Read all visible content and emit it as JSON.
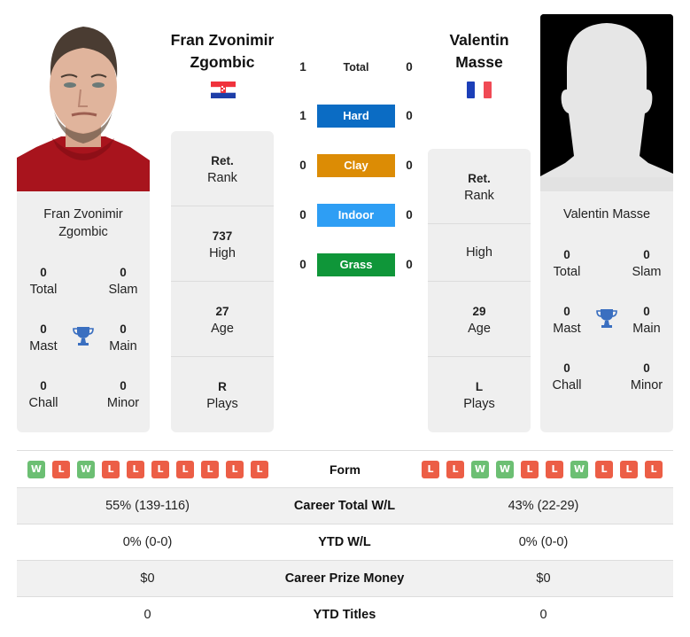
{
  "players": {
    "left": {
      "name": "Fran Zvonimir Zgombic",
      "header_name_line1": "Fran Zvonimir",
      "header_name_line2": "Zgombic",
      "card_name_line1": "Fran Zvonimir",
      "card_name_line2": "Zgombic",
      "country_flag": "croatia-flag",
      "titles": {
        "total": {
          "value": "0",
          "label": "Total"
        },
        "slam": {
          "value": "0",
          "label": "Slam"
        },
        "mast": {
          "value": "0",
          "label": "Mast"
        },
        "main": {
          "value": "0",
          "label": "Main"
        },
        "chall": {
          "value": "0",
          "label": "Chall"
        },
        "minor": {
          "value": "0",
          "label": "Minor"
        }
      },
      "rank": {
        "current": {
          "value": "Ret.",
          "label": "Rank"
        },
        "high": {
          "value": "737",
          "label": "High"
        },
        "age": {
          "value": "27",
          "label": "Age"
        },
        "plays": {
          "value": "R",
          "label": "Plays"
        }
      },
      "form": [
        "W",
        "L",
        "W",
        "L",
        "L",
        "L",
        "L",
        "L",
        "L",
        "L"
      ]
    },
    "right": {
      "name": "Valentin Masse",
      "header_name_line1": "Valentin",
      "header_name_line2": "Masse",
      "card_name_line1": "Valentin Masse",
      "country_flag": "france-flag",
      "titles": {
        "total": {
          "value": "0",
          "label": "Total"
        },
        "slam": {
          "value": "0",
          "label": "Slam"
        },
        "mast": {
          "value": "0",
          "label": "Mast"
        },
        "main": {
          "value": "0",
          "label": "Main"
        },
        "chall": {
          "value": "0",
          "label": "Chall"
        },
        "minor": {
          "value": "0",
          "label": "Minor"
        }
      },
      "rank": {
        "current": {
          "value": "Ret.",
          "label": "Rank"
        },
        "high": {
          "value": "",
          "label": "High"
        },
        "age": {
          "value": "29",
          "label": "Age"
        },
        "plays": {
          "value": "L",
          "label": "Plays"
        }
      },
      "form": [
        "L",
        "L",
        "W",
        "W",
        "L",
        "L",
        "W",
        "L",
        "L",
        "L"
      ]
    }
  },
  "h2h": [
    {
      "label": "Total",
      "left": "1",
      "right": "0",
      "color": ""
    },
    {
      "label": "Hard",
      "left": "1",
      "right": "0",
      "color": "#0b6cc4"
    },
    {
      "label": "Clay",
      "left": "0",
      "right": "0",
      "color": "#dc8c05"
    },
    {
      "label": "Indoor",
      "left": "0",
      "right": "0",
      "color": "#2e9ef4"
    },
    {
      "label": "Grass",
      "left": "0",
      "right": "0",
      "color": "#0f9639"
    }
  ],
  "form_label": "Form",
  "stats": [
    {
      "label": "Career Total W/L",
      "left": "55% (139-116)",
      "right": "43% (22-29)"
    },
    {
      "label": "YTD W/L",
      "left": "0% (0-0)",
      "right": "0% (0-0)"
    },
    {
      "label": "Career Prize Money",
      "left": "$0",
      "right": "$0"
    },
    {
      "label": "YTD Titles",
      "left": "0",
      "right": "0"
    }
  ],
  "colors": {
    "win": "#6cbf73",
    "loss": "#ec5e46",
    "trophy": "#3a6fc0",
    "card_bg": "#efefef"
  }
}
